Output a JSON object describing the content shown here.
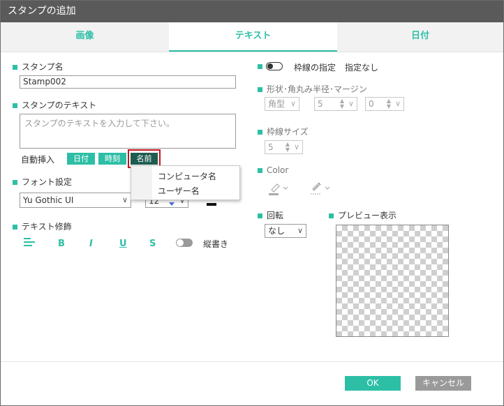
{
  "window": {
    "title": "スタンプの追加"
  },
  "tabs": [
    {
      "label": "画像"
    },
    {
      "label": "テキスト"
    },
    {
      "label": "日付"
    }
  ],
  "left": {
    "stamp_name": {
      "label": "スタンプ名",
      "value": "Stamp002"
    },
    "stamp_text": {
      "label": "スタンプのテキスト",
      "placeholder": "スタンプのテキストを入力して下さい。"
    },
    "auto_insert": {
      "label": "自動挿入",
      "buttons": [
        {
          "label": "日付"
        },
        {
          "label": "時刻"
        },
        {
          "label": "名前"
        }
      ],
      "menu": [
        {
          "label": "コンピュータ名"
        },
        {
          "label": "ユーザー名"
        }
      ]
    },
    "font": {
      "label": "フォント設定",
      "family": "Yu Gothic UI",
      "size": "12"
    },
    "decoration": {
      "label": "テキスト修飾",
      "bold": "B",
      "italic": "I",
      "underline": "U",
      "strike": "S",
      "vertical_label": "縦書き"
    }
  },
  "right": {
    "border": {
      "label": "枠線の指定",
      "status": "指定なし"
    },
    "shape": {
      "label": "形状･角丸み半径･マージン",
      "shape_value": "角型",
      "radius": "5",
      "margin": "0"
    },
    "border_size": {
      "label": "枠線サイズ",
      "value": "5"
    },
    "color": {
      "label": "Color"
    },
    "rotation": {
      "label": "回転",
      "value": "なし"
    },
    "preview": {
      "label": "プレビュー表示"
    }
  },
  "footer": {
    "ok": "OK",
    "cancel": "キャンセル"
  },
  "colors": {
    "accent": "#2dbfa6",
    "accent_dark": "#1f5c50",
    "highlight": "#c0141e",
    "titlebar": "#5a5a5a",
    "cancel_bg": "#9a9a9a"
  }
}
